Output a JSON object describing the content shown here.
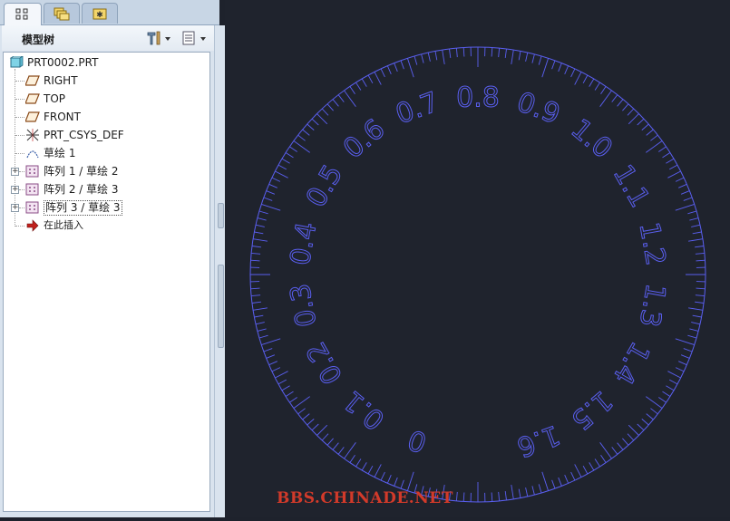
{
  "panel": {
    "tabs": [
      {
        "name": "model-tree-tab",
        "icon": "tree-icon"
      },
      {
        "name": "folder-browser-tab",
        "icon": "folders-icon"
      },
      {
        "name": "favorites-tab",
        "icon": "star-folder-icon"
      }
    ],
    "title": "模型树",
    "settings_icon": "settings-tools-icon",
    "show_icon": "show-list-icon"
  },
  "tree": {
    "items": [
      {
        "label": "PRT0002.PRT",
        "icon": "part-icon",
        "expandable": false
      },
      {
        "label": "RIGHT",
        "icon": "datum-plane-icon",
        "expandable": false
      },
      {
        "label": "TOP",
        "icon": "datum-plane-icon",
        "expandable": false
      },
      {
        "label": "FRONT",
        "icon": "datum-plane-icon",
        "expandable": false
      },
      {
        "label": "PRT_CSYS_DEF",
        "icon": "csys-icon",
        "expandable": false
      },
      {
        "label": "草绘 1",
        "icon": "sketch-icon",
        "expandable": false
      },
      {
        "label": "阵列 1 / 草绘 2",
        "icon": "pattern-icon",
        "expandable": true
      },
      {
        "label": "阵列 2 / 草绘 3",
        "icon": "pattern-icon",
        "expandable": true
      },
      {
        "label": "阵列 3 / 草绘 3",
        "icon": "pattern-icon",
        "expandable": true
      },
      {
        "label": "在此插入",
        "icon": "insert-here-arrow-icon",
        "expandable": false
      }
    ]
  },
  "dial": {
    "labels": [
      "0",
      "0.1",
      "0.2",
      "0.3",
      "0.4",
      "0.5",
      "0.6",
      "0.7",
      "0.8",
      "0.9",
      "1.0",
      "1.1",
      "1.2",
      "1.3",
      "1.4",
      "1.5",
      "1.6"
    ],
    "line_color": "#5a5ff0",
    "background": "#1f232d"
  },
  "watermark": "BBS.CHINADE.NET",
  "colors": {
    "panel_bg": "#d9e3ee",
    "accent_red": "#d23a2a"
  }
}
